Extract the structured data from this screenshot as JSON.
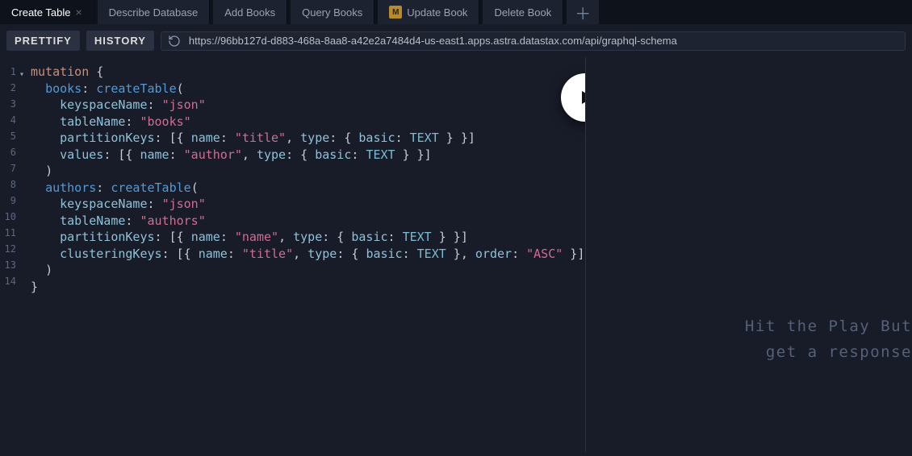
{
  "tabs": [
    {
      "label": "Create Table",
      "active": true,
      "close": true,
      "badge": ""
    },
    {
      "label": "Describe Database",
      "active": false,
      "close": false,
      "badge": ""
    },
    {
      "label": "Add Books",
      "active": false,
      "close": false,
      "badge": ""
    },
    {
      "label": "Query Books",
      "active": false,
      "close": false,
      "badge": ""
    },
    {
      "label": "Update Book",
      "active": false,
      "close": false,
      "badge": "M"
    },
    {
      "label": "Delete Book",
      "active": false,
      "close": false,
      "badge": ""
    }
  ],
  "toolbar": {
    "prettify": "PRETTIFY",
    "history": "HISTORY",
    "url": "https://96bb127d-d883-468a-8aa8-a42e2a7484d4-us-east1.apps.astra.datastax.com/api/graphql-schema"
  },
  "gutter": {
    "l1": "1",
    "l2": "2",
    "l3": "3",
    "l4": "4",
    "l5": "5",
    "l6": "6",
    "l7": "7",
    "l8": "8",
    "l9": "9",
    "l10": "10",
    "l11": "11",
    "l12": "12",
    "l13": "13",
    "l14": "14"
  },
  "code": {
    "mutation": "mutation",
    "book_alias": "books",
    "author_alias": "authors",
    "createTable": "createTable",
    "arg_keyspaceName": "keyspaceName",
    "arg_tableName": "tableName",
    "arg_partitionKeys": "partitionKeys",
    "arg_clusteringKeys": "clusteringKeys",
    "arg_values": "values",
    "arg_name": "name",
    "arg_type": "type",
    "arg_basic": "basic",
    "arg_order": "order",
    "str_json": "\"json\"",
    "str_books": "\"books\"",
    "str_authors": "\"authors\"",
    "str_title": "\"title\"",
    "str_author": "\"author\"",
    "str_name": "\"name\"",
    "str_asc": "\"ASC\"",
    "enum_TEXT": "TEXT",
    "punct_openBrace": " {",
    "punct_colon": ":",
    "punct_openParen": "(",
    "punct_closeParen": ")",
    "punct_closeBrace": "}",
    "l1_rest": " {",
    "l2_rest": ": createTable(",
    "l3_part1": "    keyspaceName: ",
    "l4_part1": "    tableName: ",
    "l5_part1": "    partitionKeys: [{ name: ",
    "l5_part2": ", type: { basic: ",
    "l5_part3": " } }]",
    "l6_part1": "    values: [{ name: ",
    "l6_part2": ", type: { basic: ",
    "l6_part3": " } }]",
    "l7": "  )",
    "l8_rest": ": createTable(",
    "l9_part1": "    keyspaceName: ",
    "l10_part1": "    tableName: ",
    "l11_part1": "    partitionKeys: [{ name: ",
    "l11_part2": ", type: { basic: ",
    "l11_part3": " } }]",
    "l12_part1": "    clusteringKeys: [{ name: ",
    "l12_part2": ", type: { basic: ",
    "l12_part3": " }, order: ",
    "l12_part4": " }]",
    "l13": "  )",
    "l14": "}"
  },
  "result_hint_a": "Hit the Play But",
  "result_hint_b": "get a response"
}
